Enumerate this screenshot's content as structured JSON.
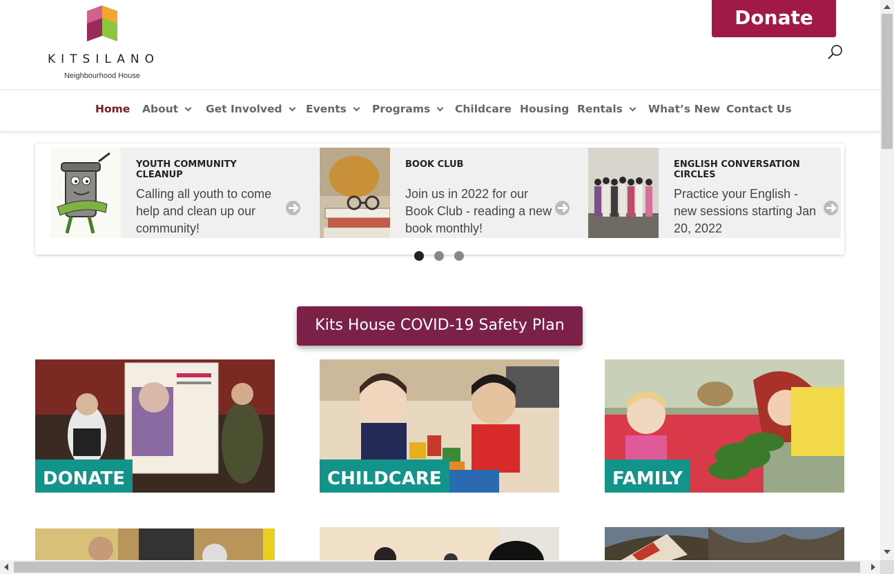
{
  "header": {
    "logo_word": "KITSILANO",
    "logo_sub": "Neighbourhood House",
    "donate_label": "Donate",
    "search_icon": "search-icon"
  },
  "nav": {
    "items": [
      {
        "label": "Home",
        "active": true,
        "dropdown": false
      },
      {
        "label": "About",
        "dropdown": true
      },
      {
        "label": "Get Involved",
        "dropdown": true
      },
      {
        "label": "Events",
        "dropdown": true
      },
      {
        "label": "Programs",
        "dropdown": true
      },
      {
        "label": "Childcare",
        "dropdown": false
      },
      {
        "label": "Housing",
        "dropdown": false
      },
      {
        "label": "Rentals",
        "dropdown": true
      },
      {
        "label": "What’s New",
        "dropdown": false
      },
      {
        "label": "Contact Us",
        "dropdown": false
      }
    ]
  },
  "slider": {
    "slides": [
      {
        "title": "Youth Community Cleanup",
        "text": "Calling all youth to come help and clean up our community!"
      },
      {
        "title": "Book Club",
        "text": "Join us in 2022 for our Book Club - reading a new book monthly!"
      },
      {
        "title": "English Conversation Circles",
        "text": "Practice your English - new sessions starting Jan 20, 2022"
      }
    ],
    "active_dot": 1
  },
  "covid": {
    "label": "Kits House COVID-19 Safety Plan"
  },
  "tiles": [
    {
      "label": "DONATE"
    },
    {
      "label": "CHILDCARE"
    },
    {
      "label": "FAMILY"
    }
  ],
  "colors": {
    "brand": "#a01a45",
    "nav_active": "#7b1a2a",
    "covid": "#7b2046",
    "tile_label": "#13948a"
  }
}
